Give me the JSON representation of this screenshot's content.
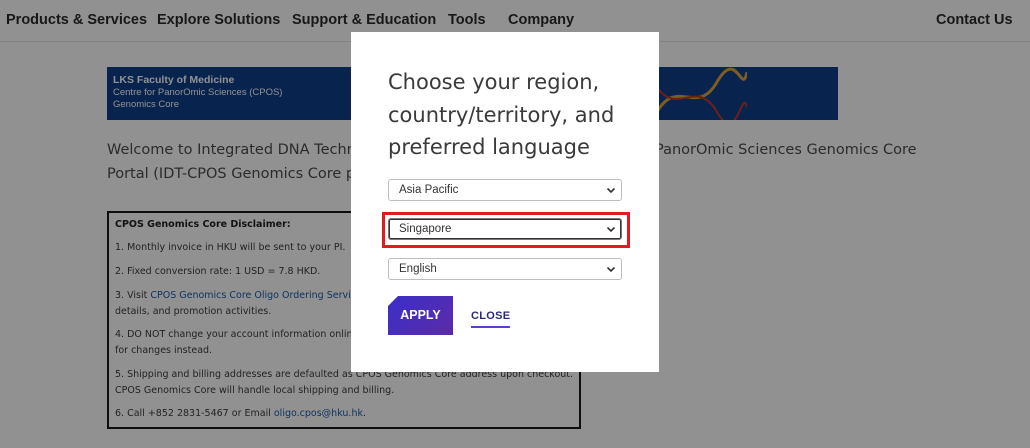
{
  "nav": {
    "items": [
      {
        "label": "Products & Services"
      },
      {
        "label": "Explore Solutions"
      },
      {
        "label": "Support & Education"
      },
      {
        "label": "Tools"
      },
      {
        "label": "Company"
      }
    ],
    "contact": "Contact Us"
  },
  "banner": {
    "line1": "LKS Faculty of Medicine",
    "line2": "Centre for PanorOmic Sciences (CPOS)",
    "line3": "Genomics Core"
  },
  "welcome": {
    "line1_left": "Welcome to Integrated DNA Techno",
    "line1_right": "PanorOmic Sciences Genomics Core",
    "line2": "Portal (IDT-CPOS Genomics Core po"
  },
  "disclaimer": {
    "title": "CPOS Genomics Core Disclaimer:",
    "item1": "1. Monthly invoice in HKU will be sent to your PI.",
    "item2": "2. Fixed conversion rate: 1 USD = 7.8 HKD.",
    "item3_prefix": "3. Visit ",
    "item3_link": "CPOS Genomics Core Oligo Ordering Service",
    "item3_line2": "details, and promotion activities.",
    "item4_line1": "4. DO NOT change your account information online",
    "item4_line2": "for changes instead.",
    "item5_line1": "5. Shipping and billing addresses are defaulted as CPOS Genomics Core address upon checkout.",
    "item5_line2": "CPOS Genomics Core will handle local shipping and billing.",
    "item6_prefix": "6. Call +852 2831-5467 or Email ",
    "item6_link": "oligo.cpos@hku.hk",
    "item6_suffix": "."
  },
  "modal": {
    "title_line1": "Choose your region,",
    "title_line2": "country/territory, and",
    "title_line3": "preferred language",
    "region": "Asia Pacific",
    "country": "Singapore",
    "language": "English",
    "apply": "APPLY",
    "close": "CLOSE"
  },
  "colors": {
    "highlight": "#e01a22",
    "apply_bg": "#4a2ec0",
    "banner_bg": "#0d3f8a"
  }
}
